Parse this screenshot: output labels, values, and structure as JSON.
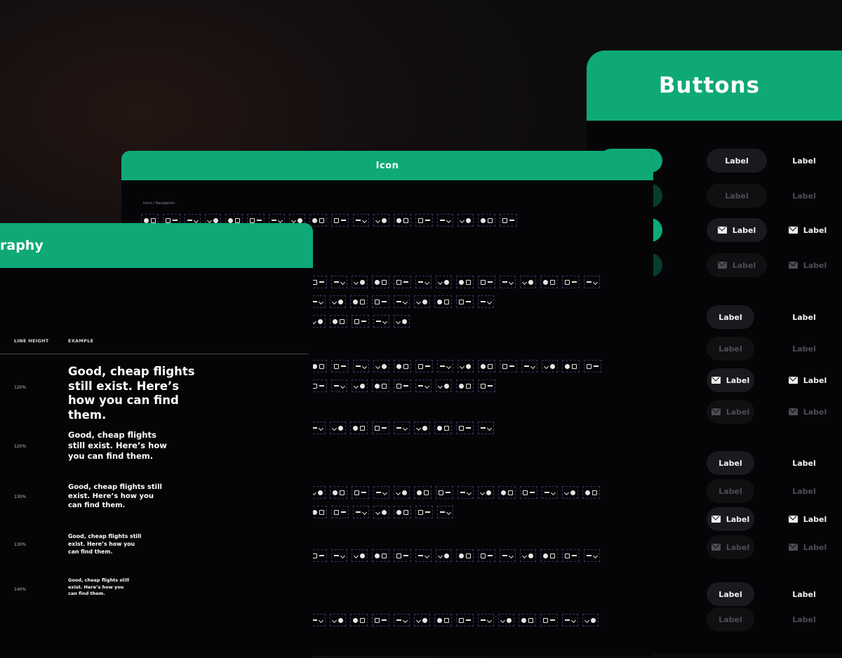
{
  "buttons_panel": {
    "title": "Buttons",
    "label": "Label"
  },
  "icon_panel": {
    "title": "Icon",
    "breadcrumb": "Icons / Navigation"
  },
  "typography_panel": {
    "title": "raphy",
    "columns": {
      "line_height": "LINE HEIGHT",
      "example": "EXAMPLE"
    },
    "rows": [
      {
        "line_height": "120%",
        "example": "Good, cheap flights still exist. Here’s how you can find them."
      },
      {
        "line_height": "120%",
        "example": "Good, cheap flights still exist. Here’s how you can find them."
      },
      {
        "line_height": "130%",
        "example": "Good, cheap flights still exist. Here’s how you can find them."
      },
      {
        "line_height": "130%",
        "example": "Good, cheap flights still exist. Here’s how you can find them."
      },
      {
        "line_height": "140%",
        "example": "Good, cheap flights still exist. Here’s how you can find them."
      }
    ]
  },
  "colors": {
    "accent": "#0ea977",
    "panel": "#050508",
    "button_dark": "#1a1a1e"
  },
  "icons": [
    "mail-icon"
  ]
}
